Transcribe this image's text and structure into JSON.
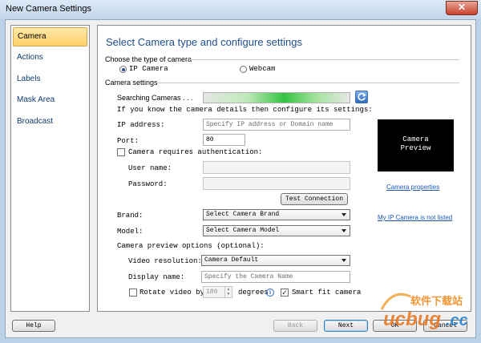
{
  "window": {
    "title": "New Camera Settings",
    "close_glyph": "✕"
  },
  "sidebar": {
    "items": [
      {
        "label": "Camera",
        "active": true
      },
      {
        "label": "Actions"
      },
      {
        "label": "Labels"
      },
      {
        "label": "Mask Area"
      },
      {
        "label": "Broadcast"
      }
    ]
  },
  "main": {
    "heading": "Select Camera type and configure settings",
    "camera_type": {
      "group_label": "Choose the type of camera",
      "options": [
        {
          "label": "IP Camera",
          "selected": true
        },
        {
          "label": "Webcam",
          "selected": false
        }
      ]
    },
    "settings": {
      "group_label": "Camera settings",
      "searching_label": "Searching Cameras . . .",
      "instruction": "If you know the camera details then configure its settings:",
      "ip_label": "IP address:",
      "ip_placeholder": "Specify IP address or Domain name",
      "port_label": "Port:",
      "port_value": "80",
      "auth_label": "Camera requires authentication:",
      "username_label": "User name:",
      "password_label": "Password:",
      "test_button": "Test Connection",
      "brand_label": "Brand:",
      "brand_value": "Select Camera Brand",
      "model_label": "Model:",
      "model_value": "Select Camera Model",
      "preview_options_label": "Camera preview options (optional):",
      "resolution_label": "Video resolution:",
      "resolution_value": "Camera Default",
      "display_name_label": "Display name:",
      "display_name_placeholder": "Specify the Camera Name",
      "rotate_label": "Rotate video by:",
      "rotate_value": "180",
      "degrees_label": "degrees",
      "smart_fit_label": "Smart fit camera",
      "smart_fit_checked": true,
      "check_glyph": "✓",
      "info_glyph": "i",
      "spin_up": "▲",
      "spin_down": "▼"
    },
    "preview": {
      "line1": "Camera",
      "line2": "Preview"
    },
    "links": {
      "camera_properties": "Camera properties",
      "not_listed": "My IP Camera is not listed"
    }
  },
  "footer": {
    "help": "Help",
    "back": "Back",
    "next": "Next",
    "ok": "OK",
    "cancel": "Cancel"
  },
  "watermark": {
    "text": "软件下载站",
    "brand": "ucbug.cc"
  }
}
